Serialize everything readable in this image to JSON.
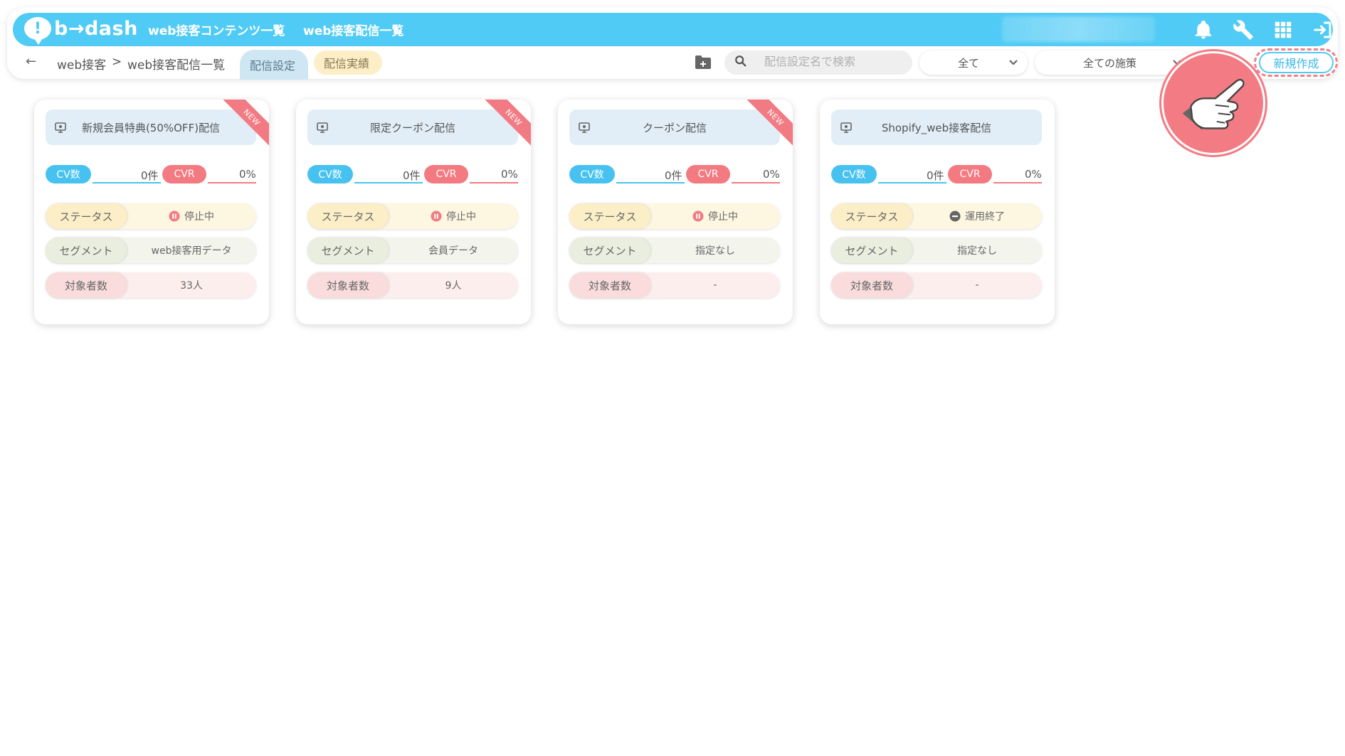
{
  "header": {
    "logo_text": "b→dash",
    "nav": [
      "web接客コンテンツ一覧",
      "web接客配信一覧"
    ]
  },
  "breadcrumb": {
    "parent": "web接客",
    "separator": ">",
    "current": "web接客配信一覧"
  },
  "tabs": {
    "settings": "配信設定",
    "results": "配信実績"
  },
  "search": {
    "placeholder": "配信設定名で検索"
  },
  "filters": {
    "status": "全て",
    "campaign": "全ての施策"
  },
  "new_button": "新規作成",
  "labels": {
    "cv": "CV数",
    "cvr": "CVR",
    "status": "ステータス",
    "segment": "セグメント",
    "target": "対象者数",
    "new_badge": "NEW"
  },
  "cards": [
    {
      "title": "新規会員特典(50%OFF)配信",
      "cv": "0件",
      "cvr": "0%",
      "status": "停止中",
      "segment": "web接客用データ",
      "target": "33人"
    },
    {
      "title": "限定クーポン配信",
      "cv": "0件",
      "cvr": "0%",
      "status": "停止中",
      "segment": "会員データ",
      "target": "9人"
    },
    {
      "title": "クーポン配信",
      "cv": "0件",
      "cvr": "0%",
      "status": "停止中",
      "segment": "指定なし",
      "target": "-"
    },
    {
      "title": "Shopify_web接客配信",
      "cv": "0件",
      "cvr": "0%",
      "status": "運用終了",
      "segment": "指定なし",
      "target": "-"
    }
  ],
  "colors": {
    "brand": "#50cbf5",
    "cv": "#47c2f0",
    "cvr": "#f37a80",
    "highlight": "#f07f86"
  }
}
